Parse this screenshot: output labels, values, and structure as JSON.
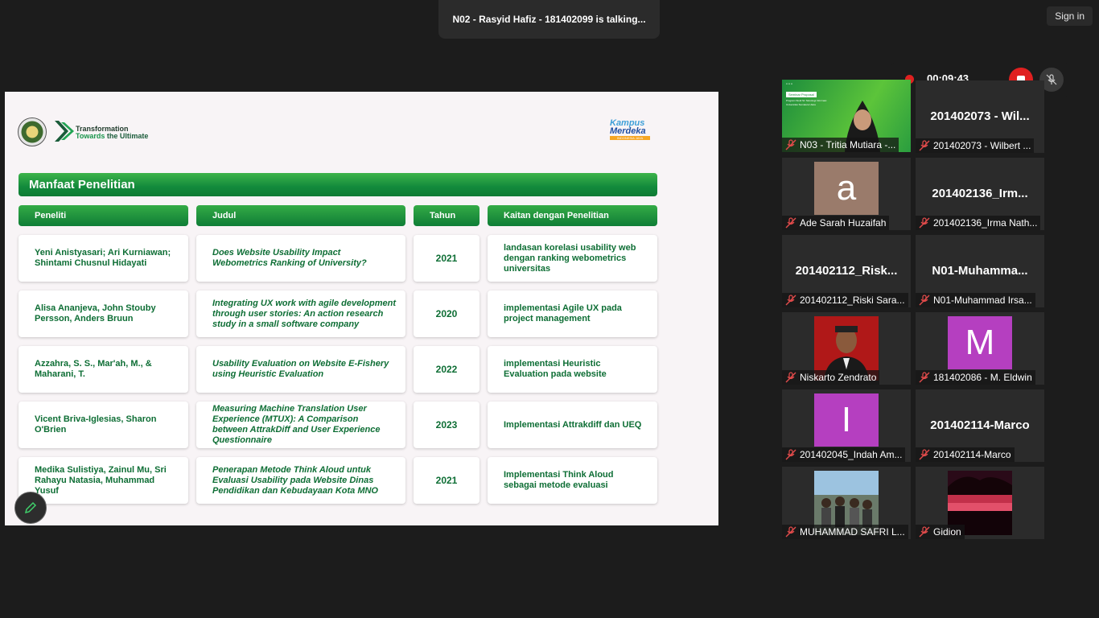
{
  "banner": {
    "talking": "N02 - Rasyid Hafiz - 181402099 is talking..."
  },
  "header": {
    "sign_in": "Sign in"
  },
  "recording": {
    "time": "00:09:43",
    "colors": {
      "rec": "#e02020"
    }
  },
  "slide": {
    "logo_text_1": "Transformation",
    "logo_text_2a": "Towards",
    "logo_text_2b": "the Ultimate",
    "kampus_1": "Kampus",
    "kampus_2": "Merdeka",
    "kampus_3": "INDONESIA JAYA",
    "title": "Manfaat Penelitian",
    "columns": [
      "Peneliti",
      "Judul",
      "Tahun",
      "Kaitan dengan Penelitian"
    ],
    "rows": [
      {
        "peneliti": "Yeni Anistyasari; Ari Kurniawan; Shintami Chusnul Hidayati",
        "judul": "Does Website Usability Impact Webometrics Ranking of University?",
        "tahun": "2021",
        "kaitan": "landasan korelasi usability web dengan ranking webometrics universitas"
      },
      {
        "peneliti": "Alisa Ananjeva, John Stouby Persson, Anders Bruun",
        "judul": "Integrating UX work with agile development through user stories: An action research study in a small software company",
        "tahun": "2020",
        "kaitan": "implementasi Agile UX pada project management"
      },
      {
        "peneliti": "Azzahra, S. S., Mar'ah, M., & Maharani, T.",
        "judul": "Usability Evaluation on Website E-Fishery using Heuristic Evaluation",
        "tahun": "2022",
        "kaitan": "implementasi Heuristic Evaluation pada website"
      },
      {
        "peneliti": "Vicent Briva-Iglesias, Sharon O'Brien",
        "judul": "Measuring Machine Translation User Experience (MTUX): A Comparison between AttrakDiff and User Experience Questionnaire",
        "tahun": "2023",
        "kaitan": "Implementasi Attrakdiff dan UEQ"
      },
      {
        "peneliti": "Medika Sulistiya, Zainul Mu, Sri Rahayu Natasia, Muhammad Yusuf",
        "judul": "Penerapan Metode Think Aloud untuk Evaluasi Usability pada Website Dinas Pendidikan dan Kebudayaan Kota MNO",
        "tahun": "2021",
        "kaitan": "Implementasi Think Aloud sebagai metode evaluasi"
      }
    ]
  },
  "participants": [
    {
      "label": "N03 - Tritia Mutiara -...",
      "big": "",
      "kind": "video"
    },
    {
      "label": "201402073 - Wilbert ...",
      "big": "201402073 - Wil...",
      "kind": "name"
    },
    {
      "label": "Ade Sarah Huzaifah",
      "big": "",
      "kind": "avatar",
      "letter": "a",
      "color": "#9a7b6b"
    },
    {
      "label": "201402136_Irma Nath...",
      "big": "201402136_Irm...",
      "kind": "name"
    },
    {
      "label": "201402112_Riski Sara...",
      "big": "201402112_Risk...",
      "kind": "name"
    },
    {
      "label": "N01-Muhammad Irsa...",
      "big": "N01-Muhamma...",
      "kind": "name"
    },
    {
      "label": "Niskarto Zendrato",
      "big": "",
      "kind": "photo-red"
    },
    {
      "label": "181402086 - M. Eldwin",
      "big": "",
      "kind": "avatar",
      "letter": "M",
      "color": "#b53fc0"
    },
    {
      "label": "201402045_Indah Am...",
      "big": "",
      "kind": "avatar",
      "letter": "I",
      "color": "#b53fc0"
    },
    {
      "label": "201402114-Marco",
      "big": "201402114-Marco",
      "kind": "name"
    },
    {
      "label": "MUHAMMAD SAFRI L...",
      "big": "",
      "kind": "photo-group"
    },
    {
      "label": "Gidion",
      "big": "",
      "kind": "photo-sunset"
    }
  ],
  "video_tile": {
    "seminar": "Seminar Proposal",
    "prodi": "Program Studi S1 Teknologi Informasi",
    "univ": "Universitas Sumatera Utara"
  }
}
